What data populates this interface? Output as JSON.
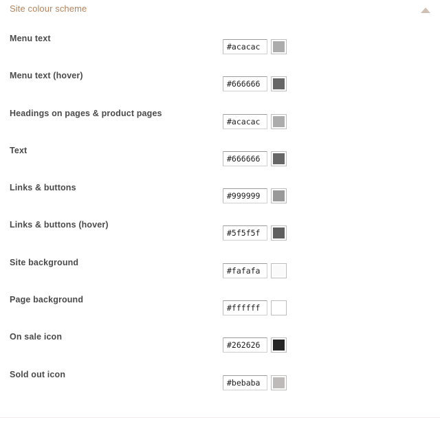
{
  "panel": {
    "title": "Site colour scheme",
    "title_color": "#b5835a",
    "collapse_icon": "triangle-up-icon",
    "collapse_icon_color": "#cfc0b4",
    "divider_color": "#f3ecea",
    "background": "#ffffff"
  },
  "rows": [
    {
      "label": "Menu text",
      "value": "#acacac",
      "swatch": "#acacac"
    },
    {
      "label": "Menu text (hover)",
      "value": "#666666",
      "swatch": "#666666"
    },
    {
      "label": "Headings on pages & product pages",
      "value": "#acacac",
      "swatch": "#acacac"
    },
    {
      "label": "Text",
      "value": "#666666",
      "swatch": "#666666"
    },
    {
      "label": "Links & buttons",
      "value": "#999999",
      "swatch": "#999999"
    },
    {
      "label": "Links & buttons (hover)",
      "value": "#5f5f5f",
      "swatch": "#5f5f5f"
    },
    {
      "label": "Site background",
      "value": "#fafafa",
      "swatch": "#fafafa"
    },
    {
      "label": "Page background",
      "value": "#ffffff",
      "swatch": "#ffffff"
    },
    {
      "label": "On sale icon",
      "value": "#262626",
      "swatch": "#262626"
    },
    {
      "label": "Sold out icon",
      "value": "#bebaba",
      "swatch": "#bebaba"
    }
  ]
}
